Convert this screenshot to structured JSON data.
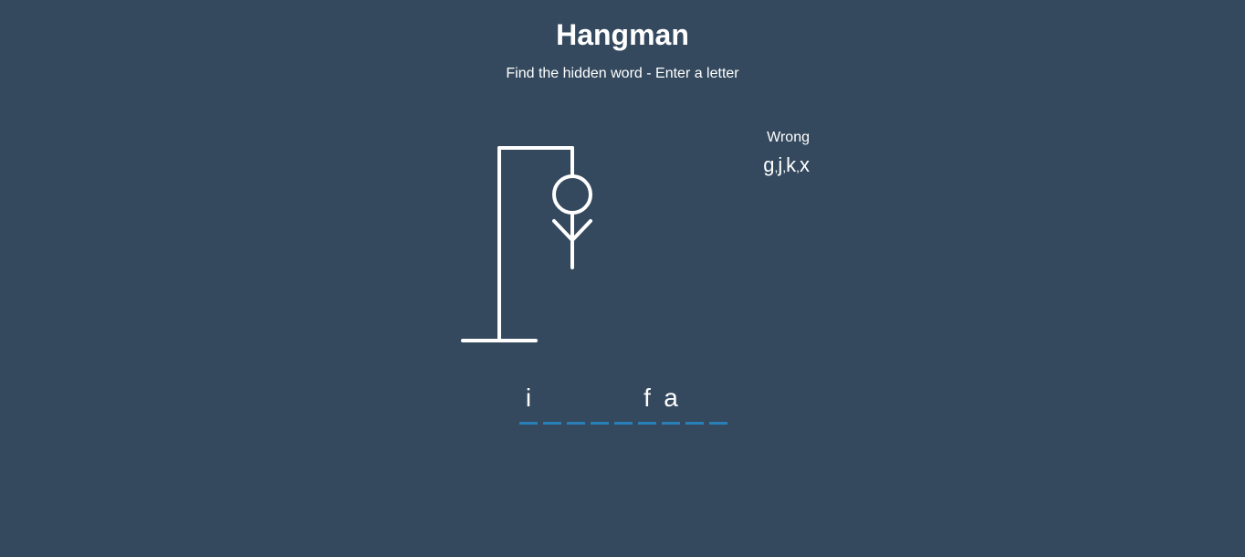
{
  "header": {
    "title": "Hangman",
    "subtitle": "Find the hidden word - Enter a letter"
  },
  "wrong": {
    "label": "Wrong",
    "letters": [
      "g",
      "j",
      "k",
      "x"
    ],
    "separator": ","
  },
  "word": {
    "letters": [
      "i",
      "",
      "",
      "",
      "",
      "f",
      "a",
      "",
      ""
    ]
  },
  "figure": {
    "parts_shown": [
      "gallows",
      "head",
      "body",
      "left-arm",
      "right-arm"
    ],
    "parts_hidden": [
      "left-leg",
      "right-leg"
    ],
    "stroke_color": "#ffffff"
  },
  "colors": {
    "background": "#34495e",
    "underline": "#2980b9",
    "text": "#ffffff"
  }
}
